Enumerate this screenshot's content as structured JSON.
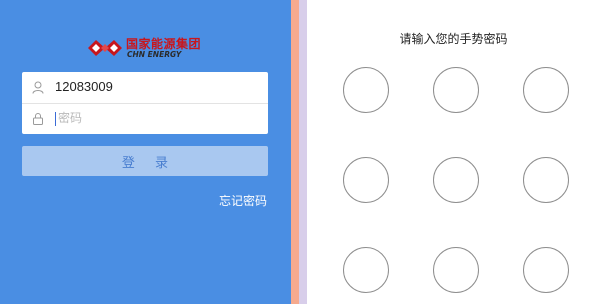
{
  "brand": {
    "name_cn": "国家能源集团",
    "name_en": "CHN ENERGY",
    "logo_color": "#c8161d"
  },
  "login": {
    "username_value": "12083009",
    "password_placeholder": "密码",
    "login_button": "登 录",
    "forgot_password": "忘记密码",
    "user_icon": "user-icon",
    "lock_icon": "lock-icon",
    "background_color": "#4a8ee3"
  },
  "gesture": {
    "title": "请输入您的手势密码",
    "dot_count": 9
  }
}
